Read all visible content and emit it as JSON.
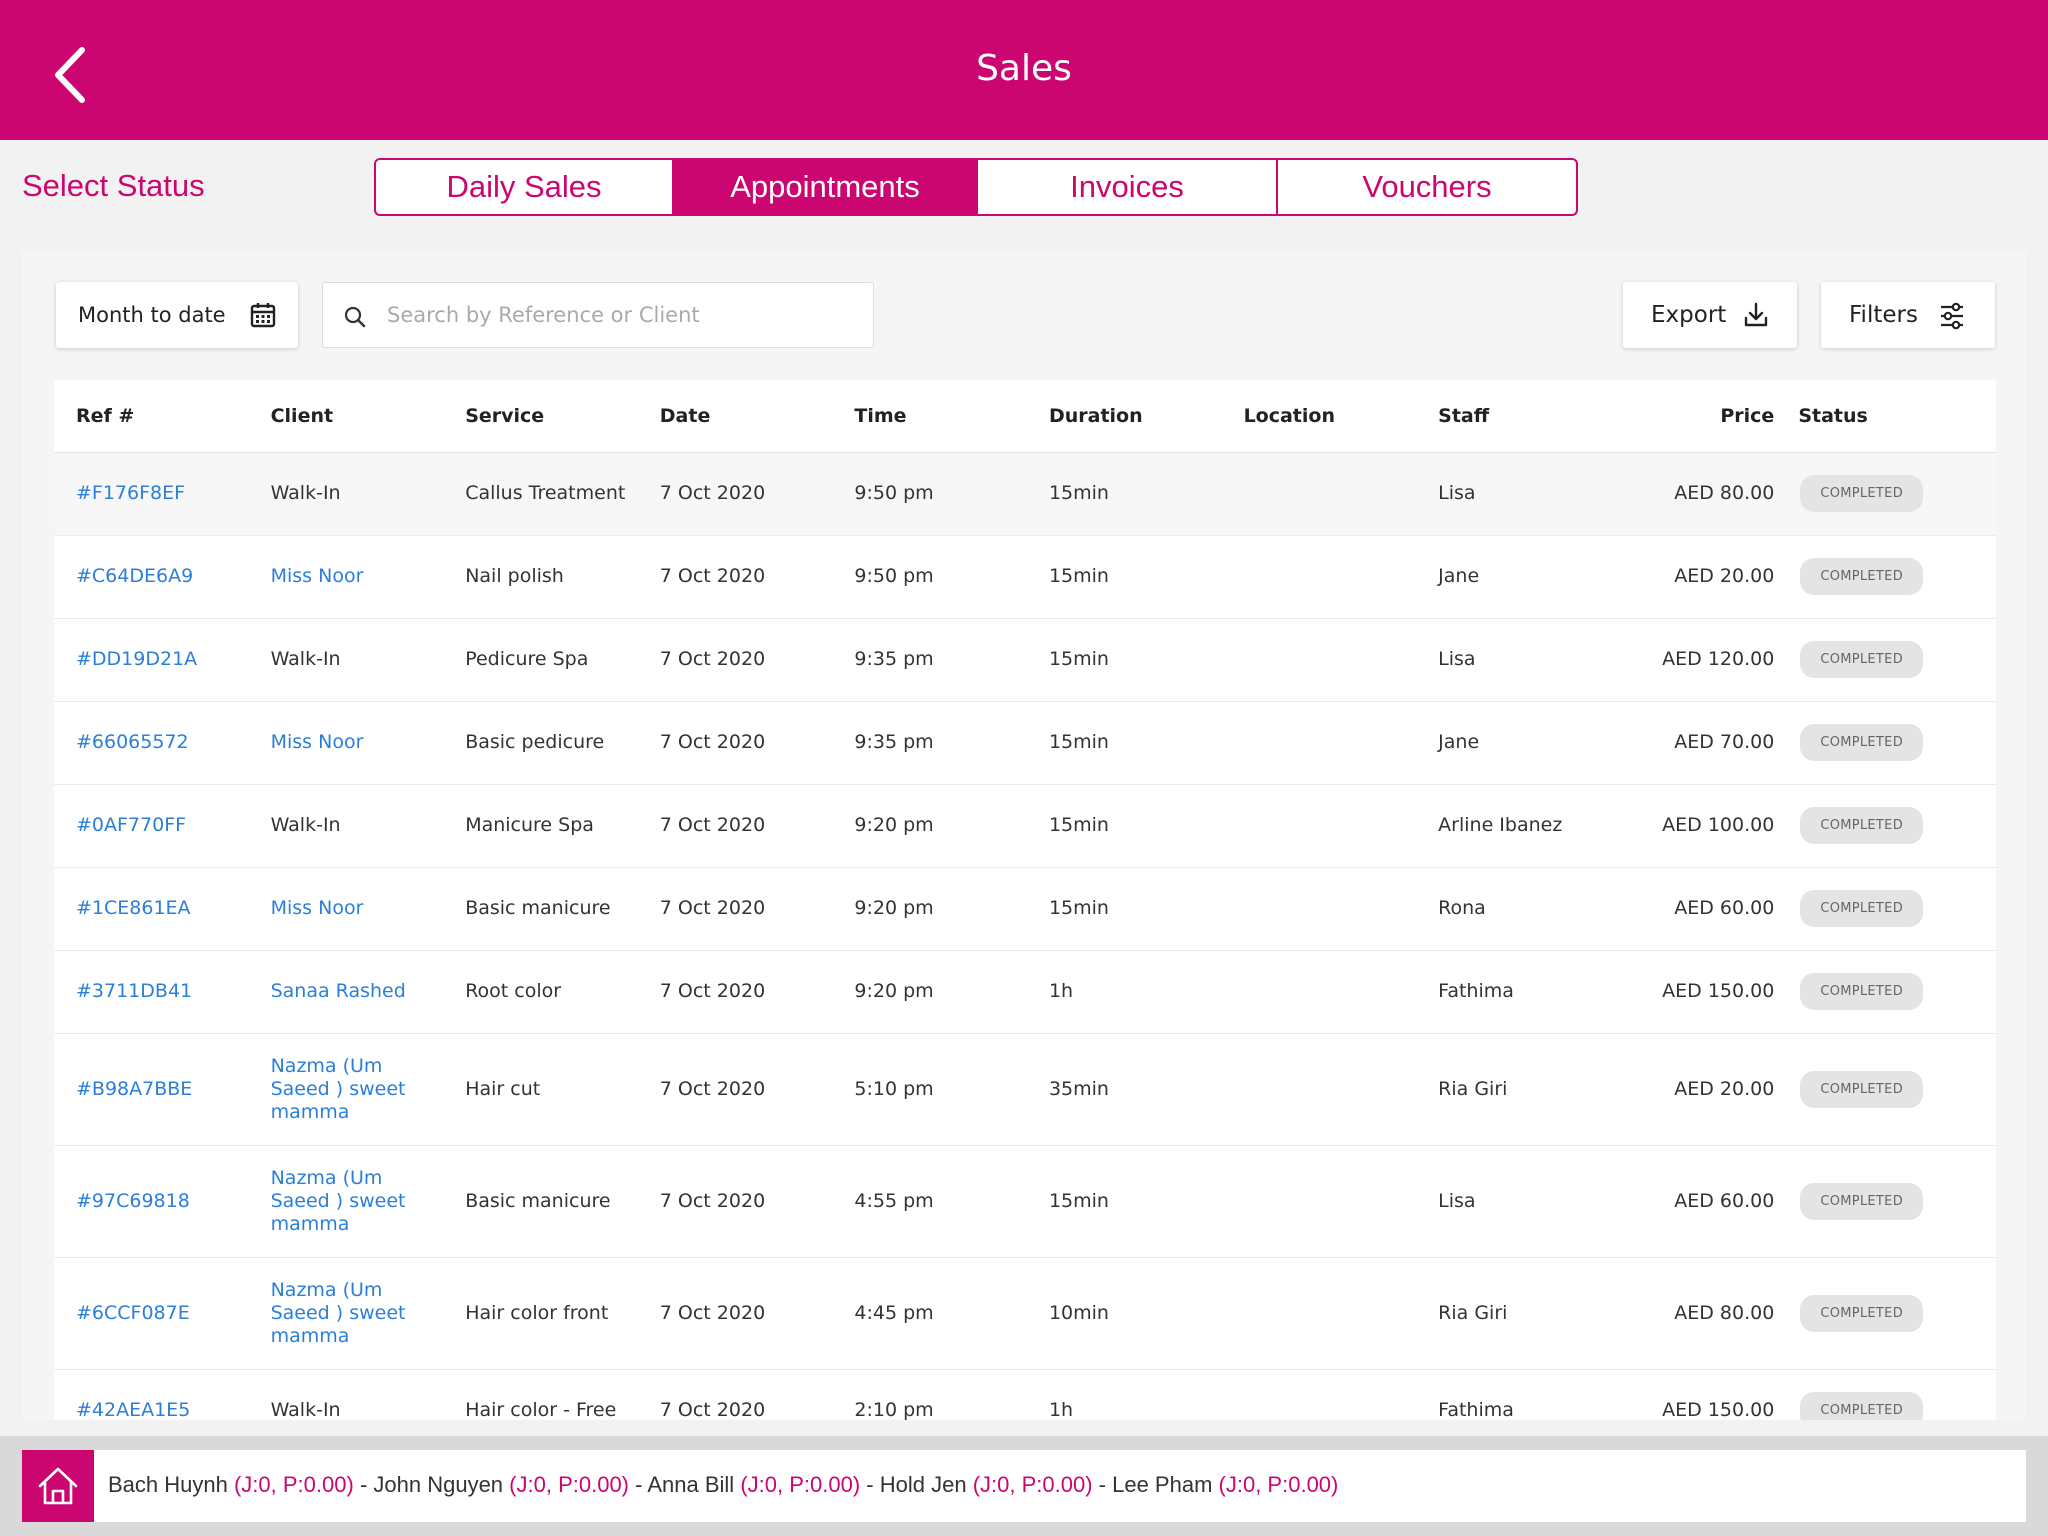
{
  "header": {
    "title": "Sales",
    "back_icon": "chevron-left-icon"
  },
  "status_bar": {
    "label": "Select Status",
    "tabs": [
      {
        "label": "Daily Sales",
        "active": false
      },
      {
        "label": "Appointments",
        "active": true
      },
      {
        "label": "Invoices",
        "active": false
      },
      {
        "label": "Vouchers",
        "active": false
      }
    ]
  },
  "toolbar": {
    "date_range": "Month to date",
    "search_placeholder": "Search by Reference or Client",
    "export_label": "Export",
    "filters_label": "Filters"
  },
  "table": {
    "columns": [
      "Ref #",
      "Client",
      "Service",
      "Date",
      "Time",
      "Duration",
      "Location",
      "Staff",
      "Price",
      "Status"
    ],
    "rows": [
      {
        "ref": "#F176F8EF",
        "client": "Walk-In",
        "client_link": false,
        "service": "Callus Treatment",
        "date": "7 Oct 2020",
        "time": "9:50 pm",
        "duration": "15min",
        "location": "",
        "staff": "Lisa",
        "price": "AED 80.00",
        "status": "COMPLETED"
      },
      {
        "ref": "#C64DE6A9",
        "client": "Miss Noor",
        "client_link": true,
        "service": "Nail polish",
        "date": "7 Oct 2020",
        "time": "9:50 pm",
        "duration": "15min",
        "location": "",
        "staff": "Jane",
        "price": "AED 20.00",
        "status": "COMPLETED"
      },
      {
        "ref": "#DD19D21A",
        "client": "Walk-In",
        "client_link": false,
        "service": "Pedicure Spa",
        "date": "7 Oct 2020",
        "time": "9:35 pm",
        "duration": "15min",
        "location": "",
        "staff": "Lisa",
        "price": "AED 120.00",
        "status": "COMPLETED"
      },
      {
        "ref": "#66065572",
        "client": "Miss Noor",
        "client_link": true,
        "service": "Basic pedicure",
        "date": "7 Oct 2020",
        "time": "9:35 pm",
        "duration": "15min",
        "location": "",
        "staff": "Jane",
        "price": "AED 70.00",
        "status": "COMPLETED"
      },
      {
        "ref": "#0AF770FF",
        "client": "Walk-In",
        "client_link": false,
        "service": "Manicure Spa",
        "date": "7 Oct 2020",
        "time": "9:20 pm",
        "duration": "15min",
        "location": "",
        "staff": "Arline Ibanez",
        "price": "AED 100.00",
        "status": "COMPLETED"
      },
      {
        "ref": "#1CE861EA",
        "client": "Miss Noor",
        "client_link": true,
        "service": "Basic manicure",
        "date": "7 Oct 2020",
        "time": "9:20 pm",
        "duration": "15min",
        "location": "",
        "staff": "Rona",
        "price": "AED 60.00",
        "status": "COMPLETED"
      },
      {
        "ref": "#3711DB41",
        "client": "Sanaa Rashed",
        "client_link": true,
        "service": "Root color",
        "date": "7 Oct 2020",
        "time": "9:20 pm",
        "duration": "1h",
        "location": "",
        "staff": "Fathima",
        "price": "AED 150.00",
        "status": "COMPLETED"
      },
      {
        "ref": "#B98A7BBE",
        "client": "Nazma (Um Saeed ) sweet mamma",
        "client_link": true,
        "service": "Hair cut",
        "date": "7 Oct 2020",
        "time": "5:10 pm",
        "duration": "35min",
        "location": "",
        "staff": "Ria Giri",
        "price": "AED 20.00",
        "status": "COMPLETED"
      },
      {
        "ref": "#97C69818",
        "client": "Nazma (Um Saeed ) sweet mamma",
        "client_link": true,
        "service": "Basic manicure",
        "date": "7 Oct 2020",
        "time": "4:55 pm",
        "duration": "15min",
        "location": "",
        "staff": "Lisa",
        "price": "AED 60.00",
        "status": "COMPLETED"
      },
      {
        "ref": "#6CCF087E",
        "client": "Nazma (Um Saeed ) sweet mamma",
        "client_link": true,
        "service": "Hair color front",
        "date": "7 Oct 2020",
        "time": "4:45 pm",
        "duration": "10min",
        "location": "",
        "staff": "Ria Giri",
        "price": "AED 80.00",
        "status": "COMPLETED"
      },
      {
        "ref": "#42AEA1E5",
        "client": "Walk-In",
        "client_link": false,
        "service": "Hair color - Free",
        "date": "7 Oct 2020",
        "time": "2:10 pm",
        "duration": "1h",
        "location": "",
        "staff": "Fathima",
        "price": "AED 150.00",
        "status": "COMPLETED"
      }
    ]
  },
  "bottom_bar": {
    "home_icon": "home-icon",
    "staff": [
      {
        "name": "Bach Huynh",
        "stat": "(J:0, P:0.00)"
      },
      {
        "name": "John Nguyen",
        "stat": "(J:0, P:0.00)"
      },
      {
        "name": "Anna Bill",
        "stat": "(J:0, P:0.00)"
      },
      {
        "name": "Hold Jen",
        "stat": "(J:0, P:0.00)"
      },
      {
        "name": "Lee Pham",
        "stat": "(J:0, P:0.00)"
      }
    ],
    "separator": " - "
  },
  "colors": {
    "brand": "#cc0670",
    "link": "#2b7fd9",
    "badge_bg": "#e4e4e4"
  }
}
